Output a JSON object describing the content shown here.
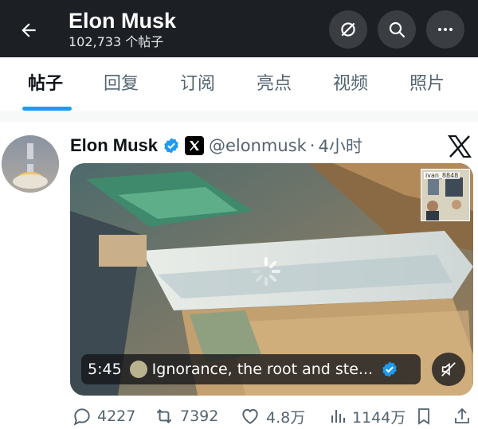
{
  "header": {
    "title": "Elon Musk",
    "subtitle": "102,733 个帖子",
    "back_icon": "arrow-left-icon",
    "buttons": [
      "subscribe-off-icon",
      "search-icon",
      "more-icon"
    ]
  },
  "tabs": [
    {
      "label": "帖子",
      "active": true
    },
    {
      "label": "回复",
      "active": false
    },
    {
      "label": "订阅",
      "active": false
    },
    {
      "label": "亮点",
      "active": false
    },
    {
      "label": "视频",
      "active": false
    },
    {
      "label": "照片",
      "active": false
    }
  ],
  "post": {
    "author": "Elon Musk",
    "handle": "@elonmusk",
    "separator": "·",
    "time": "4小时",
    "media": {
      "duration": "5:45",
      "title": "Ignorance, the root and ste...",
      "pip_label": "ivan_8848"
    },
    "stats": {
      "replies": "4227",
      "reposts": "7392",
      "likes": "4.8万",
      "views": "1144万"
    }
  },
  "colors": {
    "header_bg": "#1c1f23",
    "accent": "#1d9bf0",
    "muted_text": "#536471"
  }
}
